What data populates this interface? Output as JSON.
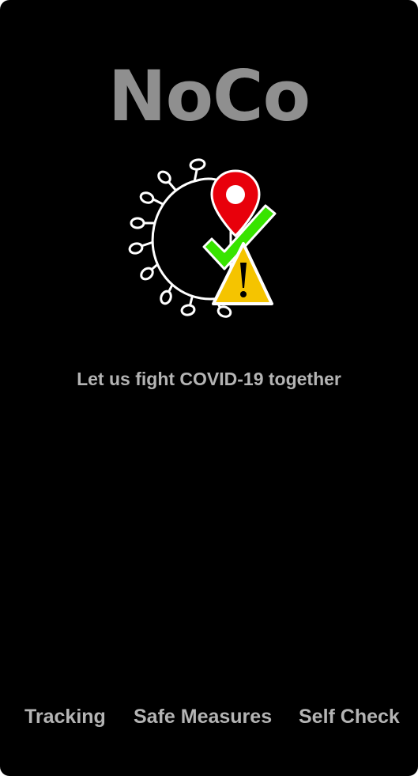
{
  "app": {
    "title": "NoCo",
    "tagline": "Let us fight COVID-19 together"
  },
  "logo": {
    "icons": [
      "virus-icon",
      "location-pin-icon",
      "checkmark-icon",
      "warning-icon"
    ],
    "colors": {
      "pin": "#e8000b",
      "check": "#38e400",
      "warning": "#f5c400",
      "outline": "#ffffff"
    }
  },
  "nav": {
    "items": [
      {
        "label": "Tracking"
      },
      {
        "label": "Safe Measures"
      },
      {
        "label": "Self Check"
      }
    ]
  },
  "theme": {
    "background": "#000000",
    "title_color": "#8f8f8f",
    "text_color": "#b4b4b4"
  }
}
